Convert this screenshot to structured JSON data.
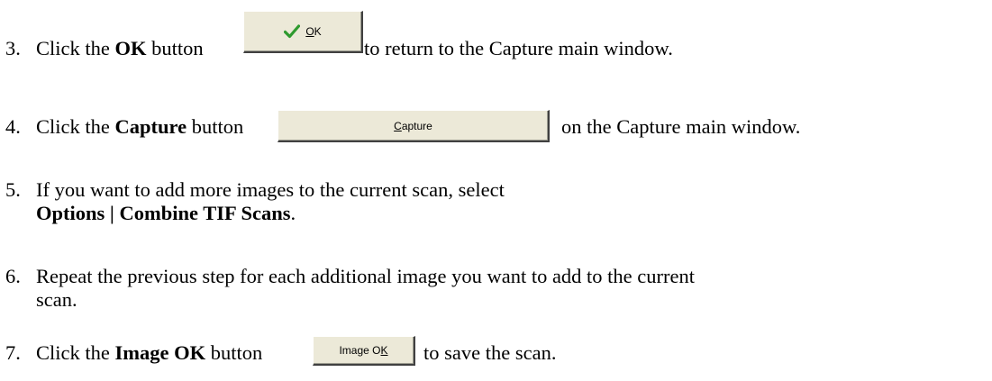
{
  "steps": [
    {
      "number": "3.",
      "text_before": "Click the ",
      "bold": "OK",
      "text_mid": " button ",
      "text_after": "to return to the Capture main window."
    },
    {
      "number": "4.",
      "text_before": "Click the ",
      "bold": "Capture",
      "text_mid": " button ",
      "text_after": "on the Capture main window."
    },
    {
      "number": "5.",
      "line1": "If you want to add more images to the current scan, select",
      "line2_bold": "Options | Combine TIF Scans",
      "line2_end": "."
    },
    {
      "number": "6.",
      "line1": "Repeat the previous step for each additional image you want to add to the current",
      "line2": "scan."
    },
    {
      "number": "7.",
      "text_before": "Click the ",
      "bold": "Image OK",
      "text_mid": " button ",
      "text_after": "to save the scan."
    }
  ],
  "buttons": {
    "ok": {
      "icon": "checkmark-icon",
      "mnemonic": "O",
      "rest": "K"
    },
    "capture": {
      "mnemonic": "C",
      "rest": "apture"
    },
    "image_ok": {
      "prefix": "Image O",
      "mnemonic": "K"
    }
  },
  "colors": {
    "check_green": "#2e9a2e",
    "button_face": "#ece9d8"
  }
}
